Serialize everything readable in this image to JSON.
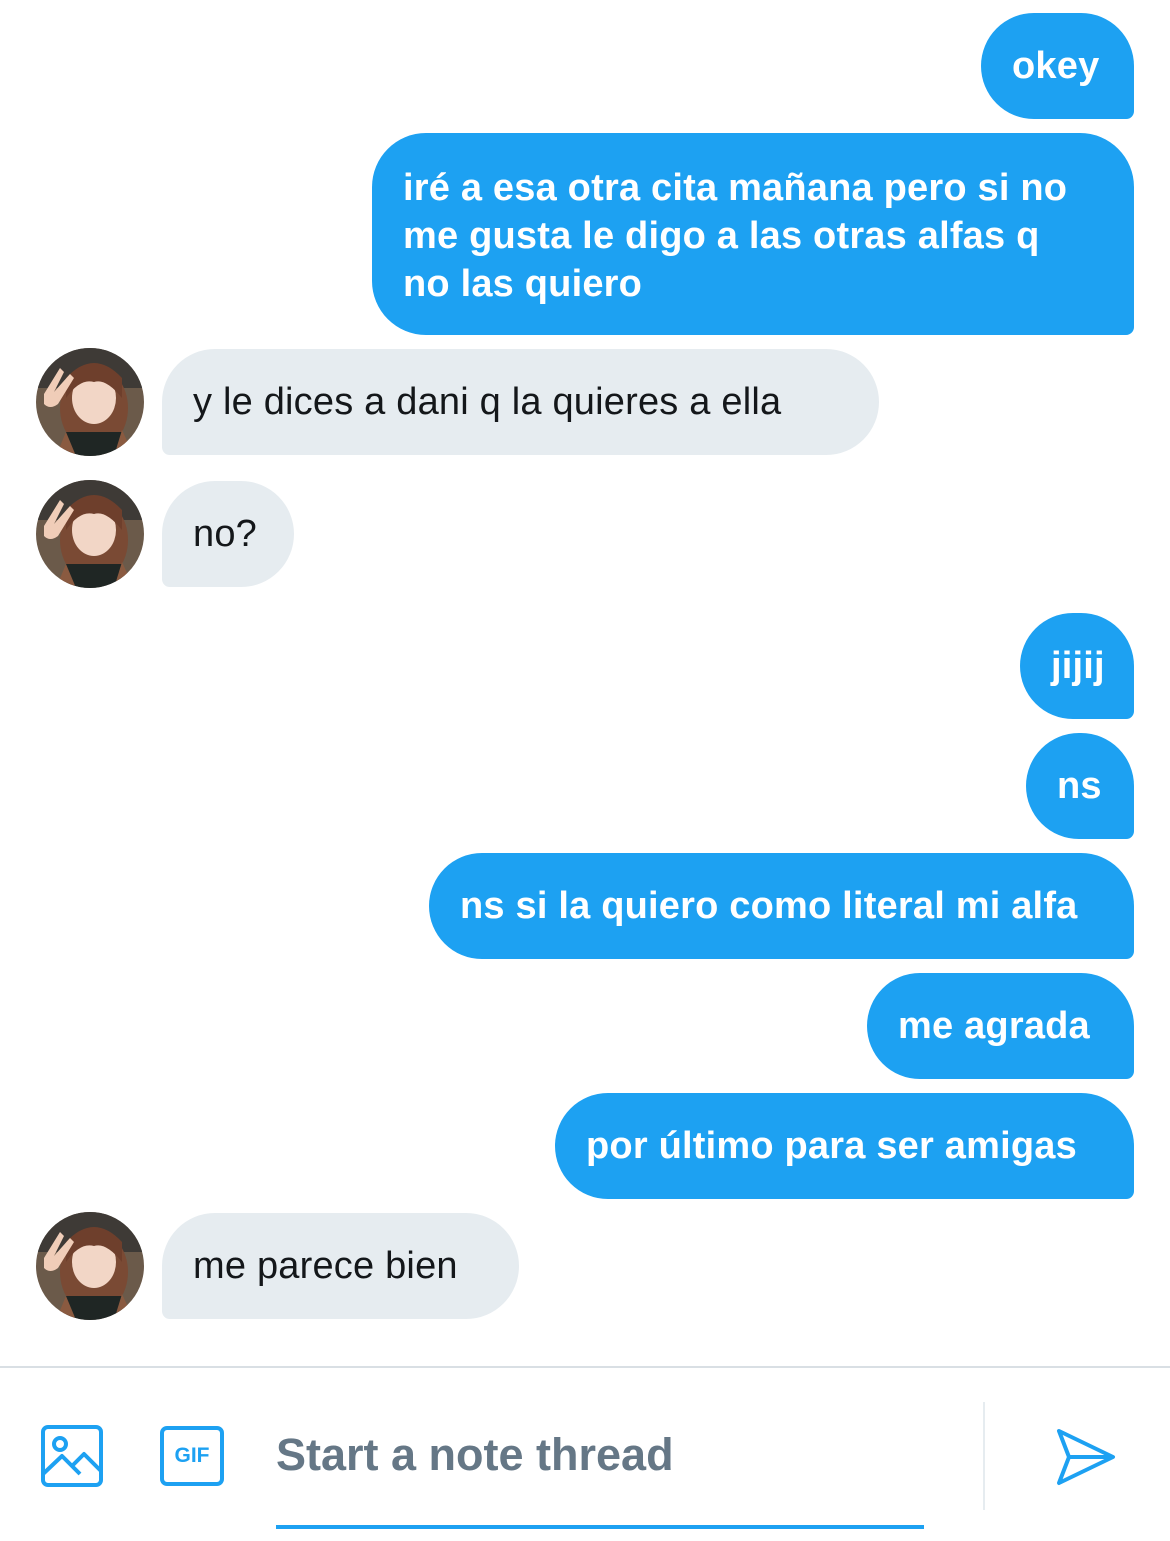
{
  "messages": {
    "m1": "okey",
    "m2_line1": "iré a esa otra cita mañana pero si no",
    "m2_line2": "me gusta le digo a las otras alfas q",
    "m2_line3": "no las quiero",
    "m3": "y le dices a dani q la quieres a ella",
    "m4": "no?",
    "m5": "jijij",
    "m6": "ns",
    "m7": "ns si la quiero como literal mi alfa",
    "m8": "me agrada",
    "m9": "por último para ser amigas",
    "m10": "me parece bien"
  },
  "composer": {
    "placeholder": "Start a note thread",
    "gif_label": "GIF",
    "media_icon": "image-icon",
    "send_icon": "send-icon"
  },
  "colors": {
    "accent": "#1da1f2",
    "incoming_bubble": "#e6ecf0",
    "placeholder_text": "#657786"
  }
}
